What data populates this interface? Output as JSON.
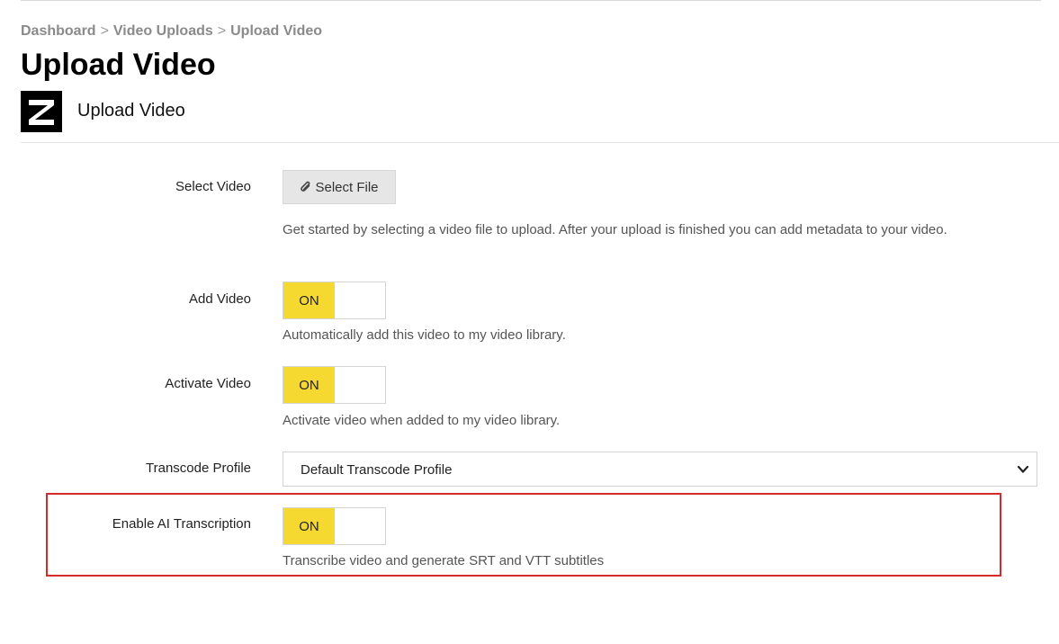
{
  "breadcrumb": {
    "items": [
      "Dashboard",
      "Video Uploads",
      "Upload Video"
    ],
    "separator": ">"
  },
  "page": {
    "title": "Upload Video",
    "subtitle": "Upload Video",
    "logo_letter": "Z"
  },
  "form": {
    "select_video": {
      "label": "Select Video",
      "button_label": "Select File",
      "button_icon": "paperclip-icon",
      "help": "Get started by selecting a video file to upload. After your upload is finished you can add metadata to your video."
    },
    "add_video": {
      "label": "Add Video",
      "toggle_text": "ON",
      "enabled": true,
      "help": "Automatically add this video to my video library."
    },
    "activate_video": {
      "label": "Activate Video",
      "toggle_text": "ON",
      "enabled": true,
      "help": "Activate video when added to my video library."
    },
    "transcode_profile": {
      "label": "Transcode Profile",
      "selected": "Default Transcode Profile",
      "icon": "chevron-down-icon"
    },
    "ai_transcription": {
      "label": "Enable AI Transcription",
      "toggle_text": "ON",
      "enabled": true,
      "help": "Transcribe video and generate SRT and VTT subtitles"
    }
  },
  "colors": {
    "toggle_on": "#f5d930",
    "highlight_border": "#d62b2b",
    "breadcrumb_text": "#8a8a8a",
    "button_bg": "#e6e6e6"
  }
}
